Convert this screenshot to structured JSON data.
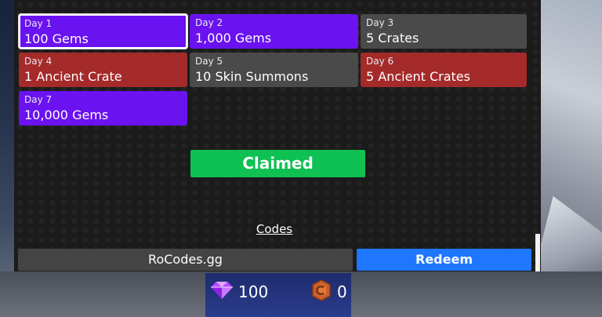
{
  "rewards": [
    {
      "day": "Day 1",
      "reward": "100 Gems",
      "color": "#6a12f0",
      "state": "selected"
    },
    {
      "day": "Day 2",
      "reward": "1,000 Gems",
      "color": "#6a12f0"
    },
    {
      "day": "Day 3",
      "reward": "5 Crates",
      "color": "#4a4a4a"
    },
    {
      "day": "Day 4",
      "reward": "1 Ancient Crate",
      "color": "#a52a2a"
    },
    {
      "day": "Day 5",
      "reward": "10 Skin Summons",
      "color": "#4a4a4a"
    },
    {
      "day": "Day 6",
      "reward": "5 Ancient Crates",
      "color": "#a52a2a"
    },
    {
      "day": "Day 7",
      "reward": "10,000 Gems",
      "color": "#6a12f0"
    }
  ],
  "claim_button": {
    "label": "Claimed",
    "color": "#0fc053"
  },
  "codes": {
    "label": "Codes",
    "input_value": "RoCodes.gg",
    "redeem_label": "Redeem",
    "redeem_color": "#1f77ff"
  },
  "currency": {
    "gems": {
      "icon": "gem-icon",
      "value": "100"
    },
    "coins": {
      "icon": "coin-icon",
      "value": "0"
    }
  }
}
